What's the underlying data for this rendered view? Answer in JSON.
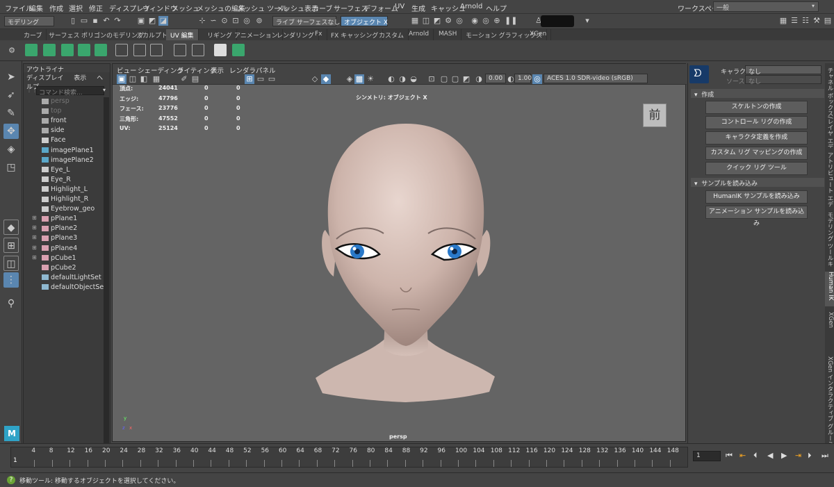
{
  "menubar": {
    "items": [
      "ファイル",
      "編集",
      "作成",
      "選択",
      "修正",
      "ディスプレイ",
      "ウィンドウ",
      "メッシュ",
      "メッシュの編集",
      "メッシュ ツール",
      "メッシュ表示",
      "カーブ",
      "サーフェス",
      "デフォーム",
      "UV",
      "生成",
      "キャッシュ",
      "Arnold",
      "ヘルプ"
    ],
    "workspace_label": "ワークスペース:",
    "workspace_value": "一般"
  },
  "statusline": {
    "mode": "モデリング",
    "live_surface": "ライブ サーフェスなし",
    "symmetry": "オブジェクト X"
  },
  "shelf": {
    "tabs": [
      "カーブ",
      "サーフェス",
      "ポリゴンのモデリング",
      "スカルプト",
      "UV 編集",
      "リギング",
      "アニメーション",
      "レンダリング",
      "Fx",
      "FX キャッシング",
      "カスタム",
      "Arnold",
      "MASH",
      "モーション グラフィックス",
      "XGen"
    ],
    "active_tab": "UV 編集"
  },
  "outliner": {
    "title": "アウトライナ",
    "menus": [
      "ディスプレイ",
      "表示",
      "ヘルプ"
    ],
    "search_placeholder": "コマンド検索...",
    "items": [
      {
        "label": "persp",
        "dim": true,
        "icon": "camera-icon",
        "expand": false
      },
      {
        "label": "top",
        "dim": true,
        "icon": "camera-icon",
        "expand": false
      },
      {
        "label": "front",
        "dim": false,
        "icon": "camera-icon",
        "expand": false
      },
      {
        "label": "side",
        "dim": false,
        "icon": "camera-icon",
        "expand": false
      },
      {
        "label": "Face",
        "dim": false,
        "icon": "mesh-icon",
        "expand": false
      },
      {
        "label": "imagePlane1",
        "dim": false,
        "icon": "image-plane-icon",
        "expand": false
      },
      {
        "label": "imagePlane2",
        "dim": false,
        "icon": "image-plane-icon",
        "expand": false
      },
      {
        "label": "Eye_L",
        "dim": false,
        "icon": "mesh-icon",
        "expand": false
      },
      {
        "label": "Eye_R",
        "dim": false,
        "icon": "mesh-icon",
        "expand": false
      },
      {
        "label": "Highlight_L",
        "dim": false,
        "icon": "mesh-icon",
        "expand": false
      },
      {
        "label": "Highlight_R",
        "dim": false,
        "icon": "mesh-icon",
        "expand": false
      },
      {
        "label": "Eyebrow_geo",
        "dim": false,
        "icon": "mesh-icon",
        "expand": false
      },
      {
        "label": "pPlane1",
        "dim": false,
        "icon": "plane-icon",
        "expand": true
      },
      {
        "label": "pPlane2",
        "dim": false,
        "icon": "plane-icon",
        "expand": true
      },
      {
        "label": "pPlane3",
        "dim": false,
        "icon": "plane-icon",
        "expand": true
      },
      {
        "label": "pPlane4",
        "dim": false,
        "icon": "plane-icon",
        "expand": true
      },
      {
        "label": "pCube1",
        "dim": false,
        "icon": "plane-icon",
        "expand": true
      },
      {
        "label": "pCube2",
        "dim": false,
        "icon": "plane-icon",
        "expand": false
      },
      {
        "label": "defaultLightSet",
        "dim": false,
        "icon": "set-icon",
        "expand": false
      },
      {
        "label": "defaultObjectSet",
        "dim": false,
        "icon": "set-icon",
        "expand": false
      }
    ]
  },
  "viewport": {
    "menus": [
      "ビュー",
      "シェーディング",
      "ライティング",
      "表示",
      "レンダラ",
      "パネル"
    ],
    "exposure": "0.00",
    "gamma": "1.00",
    "color_space": "ACES 1.0 SDR-video (sRGB)",
    "hud": [
      {
        "label": "頂点:",
        "a": "24041",
        "b": "0",
        "c": "0"
      },
      {
        "label": "エッジ:",
        "a": "47796",
        "b": "0",
        "c": "0"
      },
      {
        "label": "フェース:",
        "a": "23776",
        "b": "0",
        "c": "0"
      },
      {
        "label": "三角形:",
        "a": "47552",
        "b": "0",
        "c": "0"
      },
      {
        "label": "UV:",
        "a": "25124",
        "b": "0",
        "c": "0"
      }
    ],
    "symmetry_hud": "シンメトリ: オブジェクト X",
    "view_cube_label": "前",
    "camera_label": "persp"
  },
  "humanik": {
    "character_label": "キャラクタ:",
    "character_value": "なし",
    "source_label": "ソース:",
    "source_value": "なし",
    "section_create": "作成",
    "create_buttons": [
      "スケルトンの作成",
      "コントロール リグの作成",
      "キャラクタ定義を作成",
      "カスタム リグ マッピングの作成",
      "クイック リグ ツール"
    ],
    "section_samples": "サンプルを読み込み",
    "sample_buttons": [
      "HumanIK サンプルを読み込み",
      "アニメーション サンプルを読み込み"
    ]
  },
  "side_tabs": [
    "チャネル ボックス/レイヤ エディタ",
    "アトリビュート エディタ",
    "モデリング ツールキット",
    "Human IK",
    "XGen",
    "XGen インタラクティブ グルーミング エディタ"
  ],
  "side_tab_active": "Human IK",
  "timeline": {
    "ticks": [
      "4",
      "8",
      "12",
      "16",
      "20",
      "24",
      "28",
      "32",
      "36",
      "40",
      "44",
      "48",
      "52",
      "56",
      "60",
      "64",
      "68",
      "72",
      "76",
      "80",
      "84",
      "88",
      "92",
      "96",
      "100",
      "104",
      "108",
      "112",
      "116",
      "120",
      "124",
      "128",
      "132",
      "136",
      "140",
      "144",
      "148"
    ],
    "current_frame": "1",
    "frame_field": "1"
  },
  "helpline": {
    "text": "移動ツール: 移動するオブジェクトを選択してください。"
  },
  "colors": {
    "accent": "#5a86b0",
    "shelf_green": "#3aa66d",
    "viewport_bg": "#646464"
  }
}
